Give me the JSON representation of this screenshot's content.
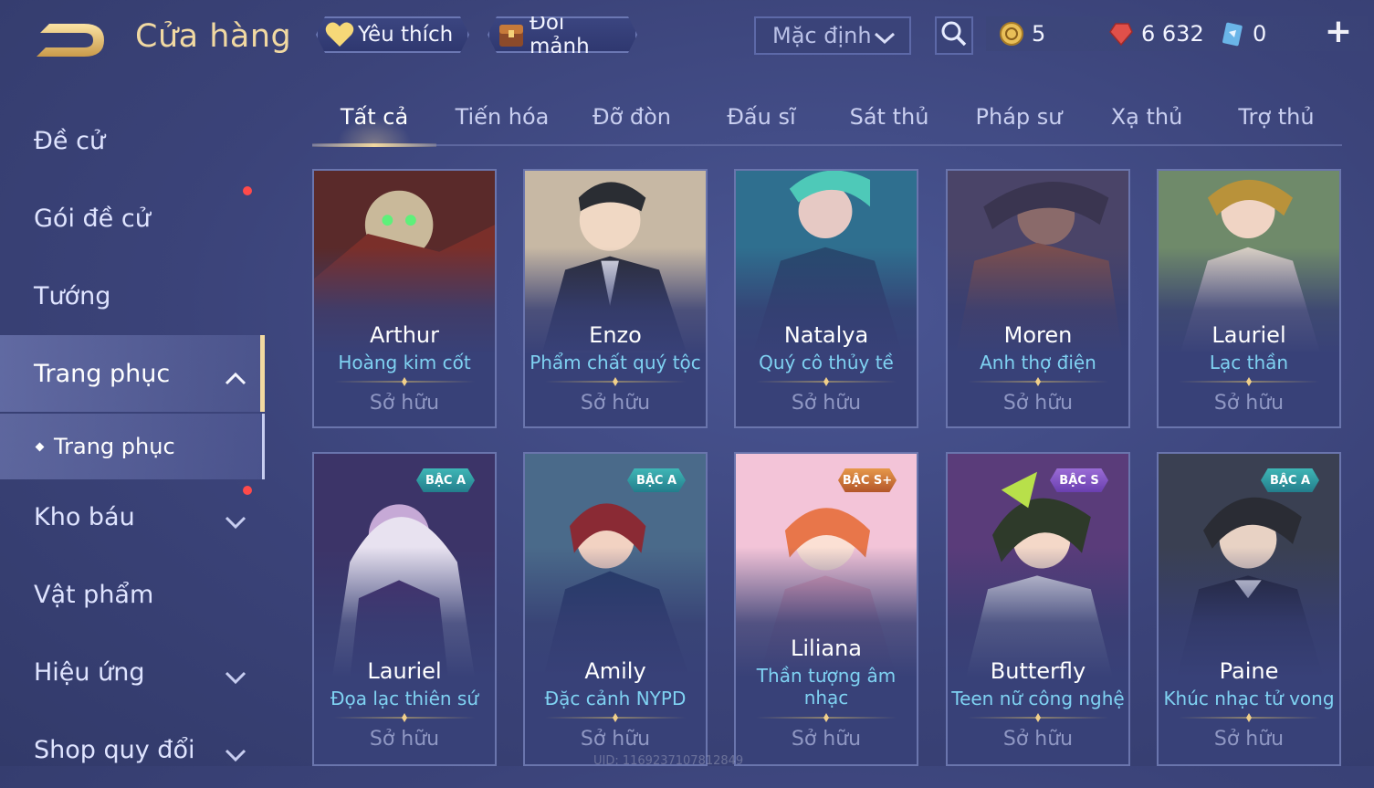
{
  "header": {
    "title": "Cửa hàng",
    "favorite_label": "Yêu thích",
    "exchange_label": "Đổi mảnh",
    "sort_value": "Mặc định",
    "currencies": [
      {
        "name": "coin",
        "value": "5"
      },
      {
        "name": "gem",
        "value": "6 632"
      },
      {
        "name": "card",
        "value": "0"
      }
    ],
    "plus_label": "+"
  },
  "sidebar": {
    "items": [
      {
        "label": "Đề cử"
      },
      {
        "label": "Gói đề cử"
      },
      {
        "label": "Tướng"
      },
      {
        "label": "Trang phục"
      },
      {
        "label": "Kho báu"
      },
      {
        "label": "Vật phẩm"
      },
      {
        "label": "Hiệu ứng"
      },
      {
        "label": "Shop quy đổi"
      }
    ],
    "sub_item": "Trang phục"
  },
  "tabs": [
    "Tất cả",
    "Tiến hóa",
    "Đỡ đòn",
    "Đấu sĩ",
    "Sát thủ",
    "Pháp sư",
    "Xạ thủ",
    "Trợ thủ"
  ],
  "cards": [
    {
      "hero": "Arthur",
      "skin": "Hoàng kim cốt",
      "status": "Sở hữu",
      "badge": ""
    },
    {
      "hero": "Enzo",
      "skin": "Phẩm chất quý tộc",
      "status": "Sở hữu",
      "badge": ""
    },
    {
      "hero": "Natalya",
      "skin": "Quý cô thủy tề",
      "status": "Sở hữu",
      "badge": ""
    },
    {
      "hero": "Moren",
      "skin": "Anh thợ điện",
      "status": "Sở hữu",
      "badge": ""
    },
    {
      "hero": "Lauriel",
      "skin": "Lạc thần",
      "status": "Sở hữu",
      "badge": ""
    },
    {
      "hero": "Lauriel",
      "skin": "Đọa lạc thiên sứ",
      "status": "Sở hữu",
      "badge": "BẬC A"
    },
    {
      "hero": "Amily",
      "skin": "Đặc cảnh NYPD",
      "status": "Sở hữu",
      "badge": "BẬC A"
    },
    {
      "hero": "Liliana",
      "skin": "Thần tượng âm nhạc",
      "status": "Sở hữu",
      "badge": "BẬC S+"
    },
    {
      "hero": "Butterfly",
      "skin": "Teen nữ công nghệ",
      "status": "Sở hữu",
      "badge": "BẬC S"
    },
    {
      "hero": "Paine",
      "skin": "Khúc nhạc tử vong",
      "status": "Sở hữu",
      "badge": "BẬC A"
    }
  ],
  "footer": {
    "uid": "UID: 1169237107812849"
  }
}
